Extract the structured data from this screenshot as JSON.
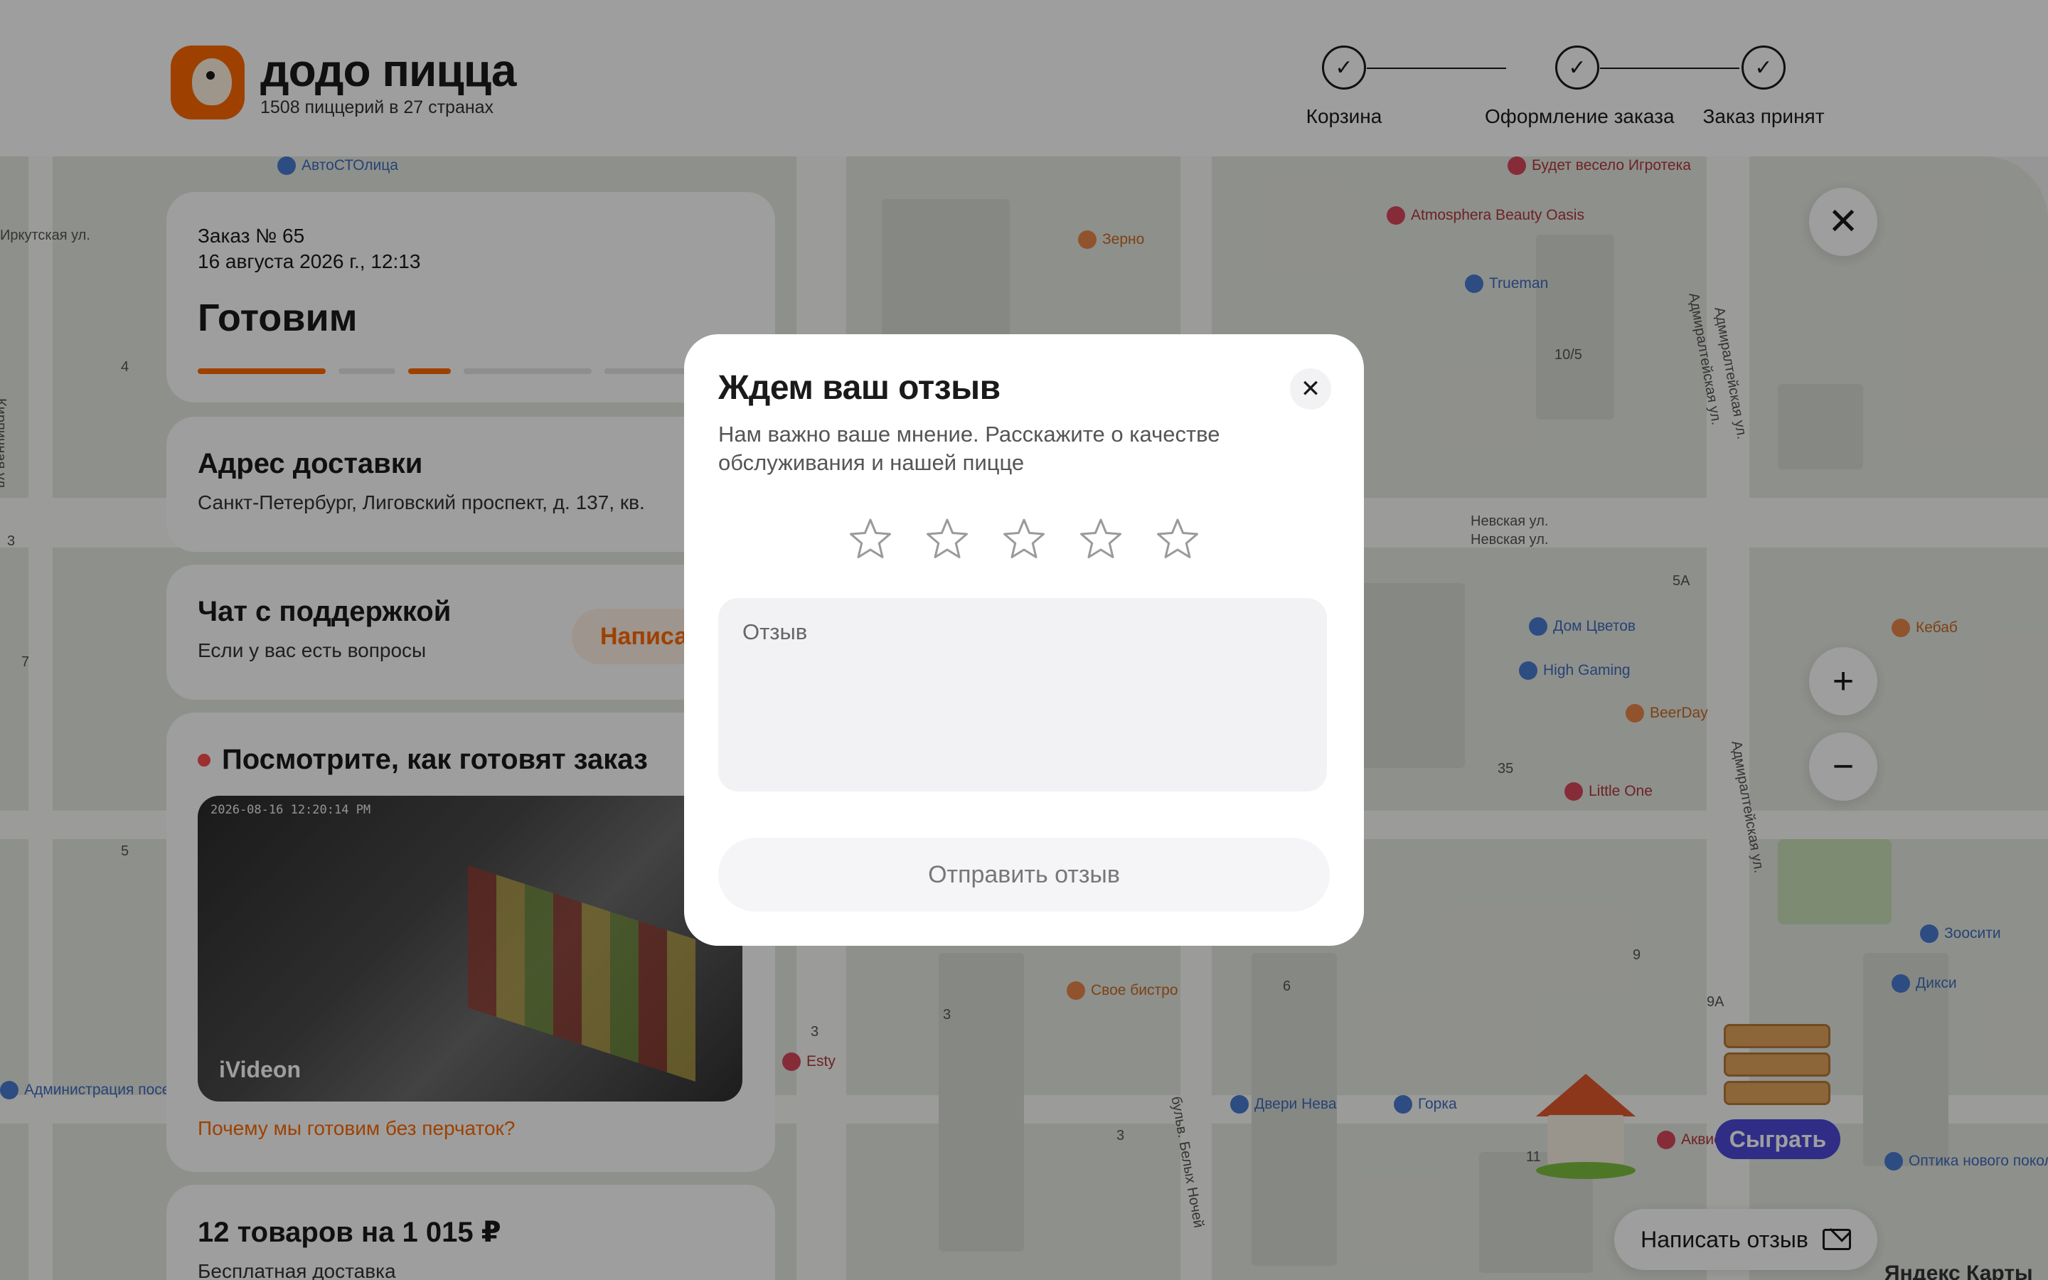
{
  "header": {
    "brand": "додо пицца",
    "tagline": "1508 пиццерий в 27 странах",
    "steps": [
      {
        "label": "Корзина",
        "mark": "✓"
      },
      {
        "label": "Оформление заказа",
        "mark": "✓"
      },
      {
        "label": "Заказ принят",
        "mark": "✓"
      }
    ]
  },
  "order": {
    "number": "Заказ № 65",
    "date": "16 августа 2026 г., 12:13",
    "status": "Готовим"
  },
  "address": {
    "title": "Адрес доставки",
    "value": "Санкт-Петербург, Лиговский проспект, д. 137, кв."
  },
  "support": {
    "title": "Чат с поддержкой",
    "subtitle": "Если у вас есть вопросы",
    "button": "Написать"
  },
  "camera": {
    "title": "Посмотрите, как готовят заказ",
    "timestamp": "2026-08-16 12:20:14 PM",
    "brand": "iVideon",
    "link": "Почему мы готовим без перчаток?"
  },
  "summary": {
    "title": "12 товаров на 1 015 ₽",
    "subtitle": "Бесплатная доставка"
  },
  "map": {
    "streets": [
      "Иркутская ул.",
      "Кирпичная ул.",
      "Невская ул.",
      "Невская ул.",
      "Адмиралтейская ул.",
      "Адмиралтейская ул.",
      "Адмиралтейская ул.",
      "бульв. Белых Ночей"
    ],
    "pois": [
      {
        "name": "АвтоСТОлица",
        "tone": "blue"
      },
      {
        "name": "Зерно",
        "tone": "orange"
      },
      {
        "name": "Atmosphera Beauty Oasis",
        "tone": "red"
      },
      {
        "name": "Будет весело Игротека",
        "tone": "red"
      },
      {
        "name": "Trueman",
        "tone": "blue"
      },
      {
        "name": "Дом Цветов",
        "tone": "blue"
      },
      {
        "name": "High Gaming",
        "tone": "blue"
      },
      {
        "name": "BeerDay",
        "tone": "orange"
      },
      {
        "name": "Little One",
        "tone": "red"
      },
      {
        "name": "Кебаб",
        "tone": "orange"
      },
      {
        "name": "Зоосити",
        "tone": "blue"
      },
      {
        "name": "Дикси",
        "tone": "blue"
      },
      {
        "name": "Свое бистро",
        "tone": "orange"
      },
      {
        "name": "Esty",
        "tone": "red"
      },
      {
        "name": "Двери Нева",
        "tone": "blue"
      },
      {
        "name": "Горка",
        "tone": "blue"
      },
      {
        "name": "Аквис+",
        "tone": "red"
      },
      {
        "name": "Оптика нового поколения",
        "tone": "blue"
      },
      {
        "name": "Администрация поселения",
        "tone": "blue"
      }
    ],
    "house_numbers": [
      "4",
      "3",
      "7",
      "5",
      "10/5",
      "5А",
      "35",
      "9",
      "9А",
      "11",
      "6",
      "3",
      "3",
      "3"
    ],
    "play_button": "Сыграть",
    "review_button": "Написать отзыв",
    "attribution": "Яндекс Карты"
  },
  "modal": {
    "title": "Ждем ваш отзыв",
    "text": "Нам важно ваше мнение. Расскажите о качестве обслуживания и нашей пицце",
    "stars": 5,
    "rating": 0,
    "placeholder": "Отзыв",
    "submit": "Отправить отзыв"
  },
  "colors": {
    "brand": "#ff6900",
    "overlay": "rgba(0,0,0,0.38)",
    "play_button": "#4c4ad9"
  },
  "icons": {
    "close": "close-icon",
    "zoom_in": "plus-icon",
    "zoom_out": "minus-icon",
    "step": "check-icon",
    "rating": "star-outline-icon",
    "review": "envelope-icon"
  }
}
